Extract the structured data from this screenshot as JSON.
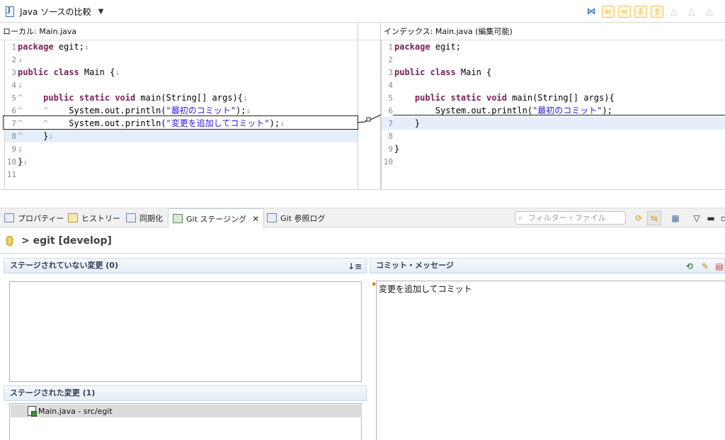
{
  "editor": {
    "title": "Java ソースの比較",
    "left_title": "ローカル: Main.java",
    "right_title": "インデックス: Main.java (編集可能)"
  },
  "left_lines": [
    {
      "n": "1",
      "ind": "",
      "kw": "package",
      "text": " egit;",
      "str": "",
      "tail": "",
      "ws": "↓",
      "hl": false
    },
    {
      "n": "2",
      "ind": "",
      "kw": "",
      "text": "",
      "str": "",
      "tail": "",
      "ws": "↓",
      "hl": false
    },
    {
      "n": "3",
      "ind": "",
      "kw": "public class",
      "text": " Main {",
      "str": "",
      "tail": "",
      "ws": "↓",
      "hl": false
    },
    {
      "n": "4",
      "ind": "",
      "kw": "",
      "text": "",
      "str": "",
      "tail": "",
      "ws": "↓",
      "hl": false
    },
    {
      "n": "5",
      "ind": "^    ",
      "kw": "public static void",
      "text": " main(String[] args){",
      "str": "",
      "tail": "",
      "ws": "↓",
      "hl": false
    },
    {
      "n": "6",
      "ind": "^    ^    ",
      "kw": "",
      "text": "System.out.println(",
      "str": "\"最初のコミット\"",
      "tail": ");",
      "ws": "↓",
      "hl": false
    },
    {
      "n": "7",
      "ind": "^    ^    ",
      "kw": "",
      "text": "System.out.println(",
      "str": "\"変更を追加してコミット\"",
      "tail": ");",
      "ws": "↓",
      "hl": false
    },
    {
      "n": "8",
      "ind": "^    ",
      "kw": "",
      "text": "}",
      "str": "",
      "tail": "",
      "ws": "↓",
      "hl": true
    },
    {
      "n": "9",
      "ind": "",
      "kw": "",
      "text": "",
      "str": "",
      "tail": "",
      "ws": "↓",
      "hl": false
    },
    {
      "n": "10",
      "ind": "",
      "kw": "",
      "text": "}",
      "str": "",
      "tail": "",
      "ws": "↓",
      "hl": false
    },
    {
      "n": "11",
      "ind": "",
      "kw": "",
      "text": "",
      "str": "",
      "tail": "",
      "ws": "",
      "hl": false
    }
  ],
  "right_lines": [
    {
      "n": "1",
      "ind": "",
      "kw": "package",
      "text": " egit;",
      "str": "",
      "tail": "",
      "ws": "",
      "hl": false
    },
    {
      "n": "2",
      "ind": "",
      "kw": "",
      "text": "",
      "str": "",
      "tail": "",
      "ws": "",
      "hl": false
    },
    {
      "n": "3",
      "ind": "",
      "kw": "public class",
      "text": " Main {",
      "str": "",
      "tail": "",
      "ws": "",
      "hl": false
    },
    {
      "n": "4",
      "ind": "",
      "kw": "",
      "text": "",
      "str": "",
      "tail": "",
      "ws": "",
      "hl": false
    },
    {
      "n": "5",
      "ind": "    ",
      "kw": "public static void",
      "text": " main(String[] args){",
      "str": "",
      "tail": "",
      "ws": "",
      "hl": false
    },
    {
      "n": "6",
      "ind": "        ",
      "kw": "",
      "text": "System.out.println(",
      "str": "\"最初のコミット\"",
      "tail": ");",
      "ws": "",
      "hl": false
    },
    {
      "n": "7",
      "ind": "    ",
      "kw": "",
      "text": "}",
      "str": "",
      "tail": "",
      "ws": "",
      "hl": true
    },
    {
      "n": "8",
      "ind": "",
      "kw": "",
      "text": "",
      "str": "",
      "tail": "",
      "ws": "",
      "hl": false
    },
    {
      "n": "9",
      "ind": "",
      "kw": "",
      "text": "}",
      "str": "",
      "tail": "",
      "ws": "",
      "hl": false
    },
    {
      "n": "10",
      "ind": "",
      "kw": "",
      "text": "",
      "str": "",
      "tail": "",
      "ws": "",
      "hl": false
    }
  ],
  "tabs": {
    "properties": "プロパティー",
    "history": "ヒストリー",
    "sync": "同期化",
    "staging": "Git ステージング",
    "reflog": "Git 参照ログ"
  },
  "filter": {
    "placeholder": "フィルター・ファイル"
  },
  "staging": {
    "repo": "> egit [develop]",
    "unstaged_title": "ステージされていない変更 (0)",
    "staged_title": "ステージされた変更 (1)",
    "staged_files": [
      "Main.java - src/egit"
    ],
    "commit_title": "コミット・メッセージ",
    "commit_message": "変更を追加してコミット"
  },
  "icons": {
    "toolbar": [
      "compare-mode-icon",
      "copy-all-left-icon",
      "copy-right-icon",
      "next-diff-icon",
      "prev-diff-icon",
      "next-change-icon",
      "prev-change-icon",
      "ancestor-icon"
    ],
    "tab_toolbar": [
      "sync-icon",
      "link-icon",
      "layout-icon",
      "view-menu-icon",
      "minimize-icon",
      "maximize-icon"
    ]
  },
  "colors": {
    "keyword": "#7a1f56",
    "string": "#2a1bdc",
    "highlight": "#e5eefa"
  }
}
